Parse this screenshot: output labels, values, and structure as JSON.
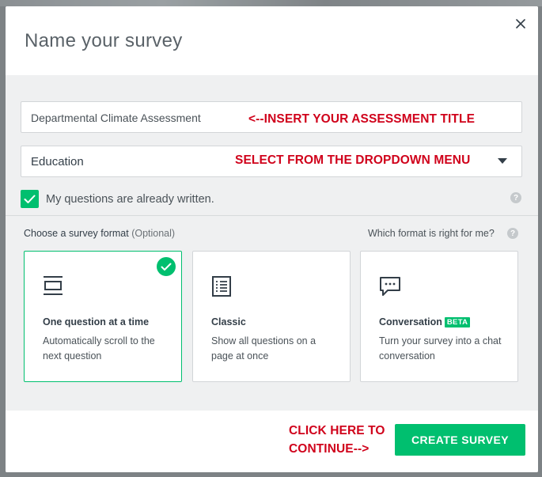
{
  "modal": {
    "title": "Name your survey",
    "close_icon": "close-icon"
  },
  "survey_title_field": {
    "value": "Departmental Climate Assessment",
    "annotation": "<--INSERT YOUR ASSESSMENT TITLE"
  },
  "category_field": {
    "selected": "Education",
    "annotation": "SELECT FROM THE DROPDOWN MENU"
  },
  "questions_written": {
    "checked": true,
    "label": "My questions are already written."
  },
  "format": {
    "label": "Choose a survey format",
    "optional": "(Optional)",
    "help_link": "Which format is right for me?",
    "cards": [
      {
        "title": "One question at a time",
        "description": "Automatically scroll to the next question",
        "icon": "one-question-icon",
        "selected": true
      },
      {
        "title": "Classic",
        "description": "Show all questions on a page at once",
        "icon": "classic-list-icon",
        "selected": false
      },
      {
        "title": "Conversation",
        "badge": "BETA",
        "description": "Turn your survey into a chat conversation",
        "icon": "chat-bubble-icon",
        "selected": false
      }
    ]
  },
  "footer": {
    "annotation_line1": "CLICK HERE TO",
    "annotation_line2": "CONTINUE-->",
    "create_button": "CREATE SURVEY"
  },
  "colors": {
    "accent": "#00bf6f",
    "annotation": "#d0021b",
    "panel": "#eff0f1"
  }
}
